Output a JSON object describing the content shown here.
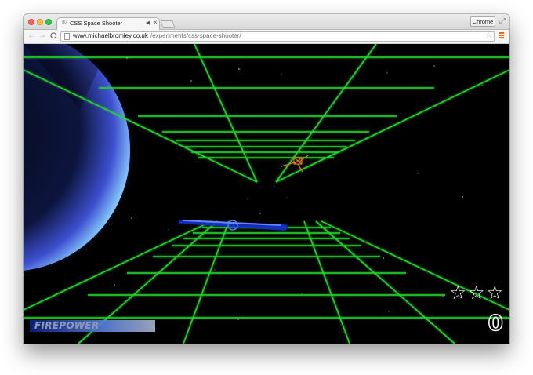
{
  "browser": {
    "tab": {
      "favicon_text": "IM",
      "title": "CSS Space Shooter",
      "audio_icon": "◀︎",
      "close_glyph": "×"
    },
    "profile_button_label": "Chrome",
    "fullscreen_icon": "⤢",
    "nav": {
      "back_icon": "←",
      "forward_icon": "→",
      "reload_icon": "C"
    },
    "url_domain": "www.michaelbromley.co.uk",
    "url_path": "/experiments/css-space-shooter/",
    "star_icon": "☆",
    "menu_icon": "menu-icon"
  },
  "game": {
    "score": "0",
    "lives": [
      "☆",
      "☆",
      "☆"
    ],
    "firepower_label": "FIREPOWER",
    "colors": {
      "grid": "#29cf2e",
      "grid_glow": "#0f7f18",
      "ship": "#2d5cff",
      "enemy": "#e07a28",
      "planet": "#6f8dff",
      "background": "#000000"
    }
  }
}
